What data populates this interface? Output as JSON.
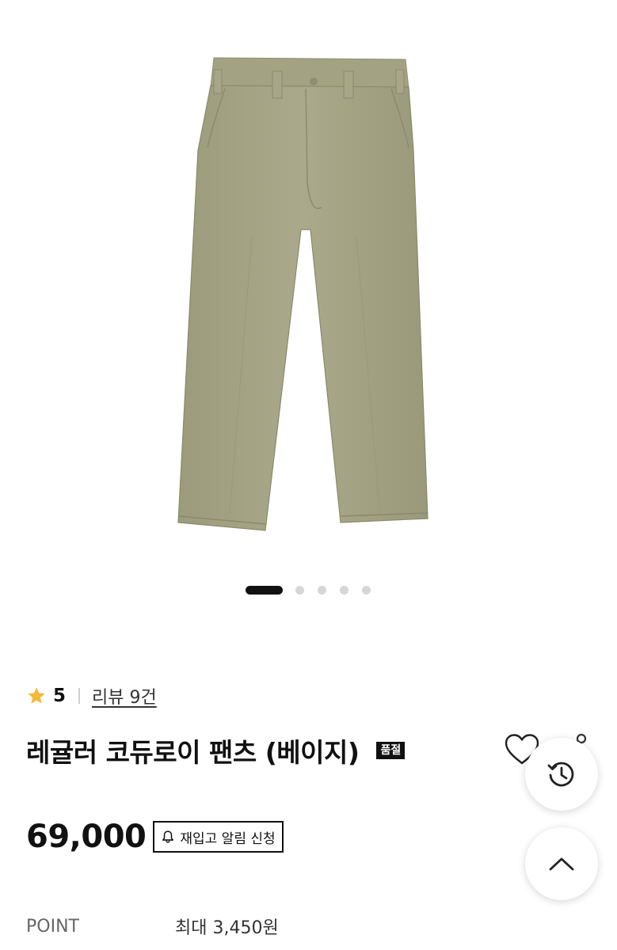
{
  "product": {
    "image_alt": "Regular corduroy pants beige product photo",
    "carousel": {
      "total": 5,
      "active_index": 0
    },
    "rating": {
      "value": "5",
      "review_link": "리뷰 9건"
    },
    "title": "레귤러 코듀로이 팬츠 (베이지)",
    "status_badge": "품절",
    "price": "69,000",
    "restock_button": "재입고 알림 신청",
    "point": {
      "label": "POINT",
      "value": "최대 3,450원"
    }
  },
  "actions": {
    "wish_icon": "heart-outline-icon",
    "share_icon": "share-icon",
    "recent_icon": "history-icon",
    "top_icon": "chevron-up-icon"
  },
  "colors": {
    "star": "#f4b93b",
    "pants": "#a4a384",
    "badge_bg": "#111111"
  }
}
